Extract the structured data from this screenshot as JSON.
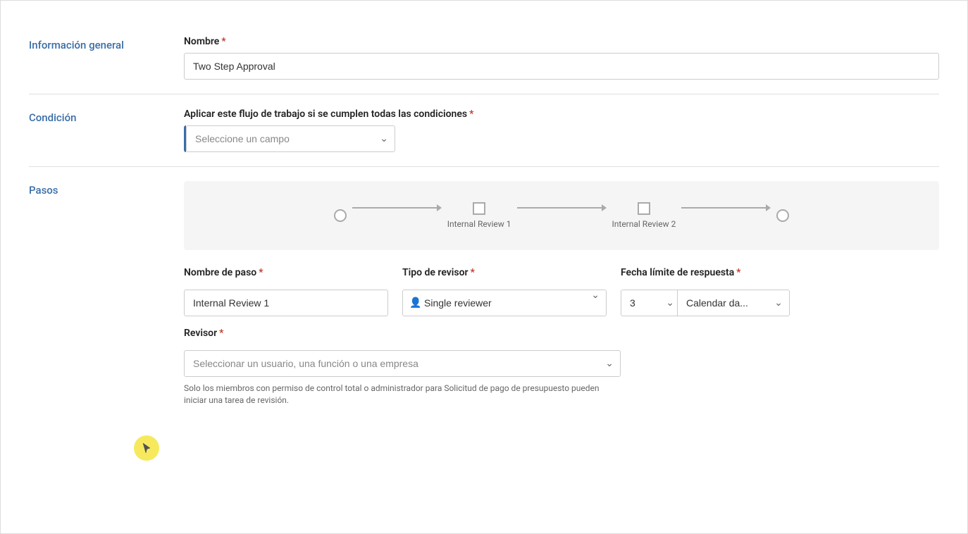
{
  "sections": {
    "general": {
      "label": "Información general",
      "nombre_label": "Nombre",
      "required_marker": "*",
      "nombre_value": "Two Step Approval"
    },
    "condicion": {
      "label": "Condición",
      "field_label": "Aplicar este flujo de trabajo si se cumplen todas las condiciones",
      "required_marker": "*",
      "select_placeholder": "Seleccione un campo"
    },
    "pasos": {
      "label": "Pasos",
      "step1_label": "Internal Review 1",
      "step2_label": "Internal Review 2",
      "form": {
        "nombre_paso_label": "Nombre de paso",
        "nombre_paso_required": "*",
        "nombre_paso_value": "Internal Review 1",
        "tipo_revisor_label": "Tipo de revisor",
        "tipo_revisor_required": "*",
        "tipo_revisor_value": "Single reviewer",
        "tipo_revisor_icon": "👤",
        "fecha_label": "Fecha límite de respuesta",
        "fecha_required": "*",
        "fecha_num_value": "3",
        "fecha_cal_value": "Calendar da...",
        "revisor_label": "Revisor",
        "revisor_required": "*",
        "revisor_placeholder": "Seleccionar un usuario, una función o una empresa",
        "helper_text": "Solo los miembros con permiso de control total o administrador para Solicitud de pago de presupuesto pueden iniciar una tarea de revisión."
      }
    }
  }
}
